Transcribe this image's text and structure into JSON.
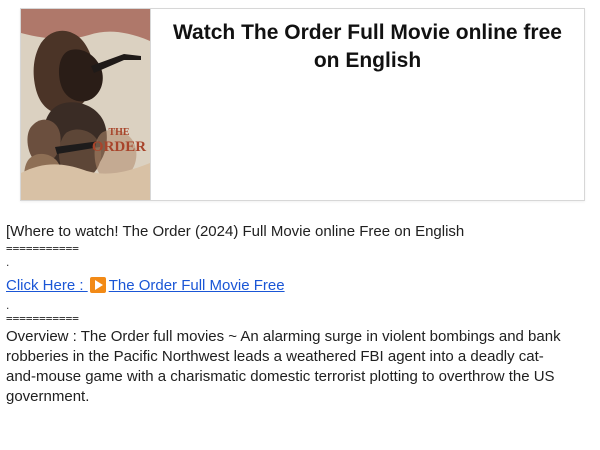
{
  "card": {
    "title": "Watch The Order Full Movie online free on English",
    "poster_word": "THE ORDER"
  },
  "content": {
    "intro": "[Where to watch! The Order (2024) Full Movie online Free on English",
    "separator": "===========",
    "dot": ".",
    "link_prefix": "Click Here : ",
    "link_icon": "play-icon",
    "link_text": "The Order Full Movie Free",
    "overview": "Overview : The Order full movies ~ An alarming surge in violent bombings and bank robberies in the Pacific Northwest leads a weathered FBI agent into a deadly cat-and-mouse game with a charismatic domestic terrorist plotting to overthrow the US government."
  },
  "colors": {
    "link": "#1a56d6",
    "play_icon": "#f28a16",
    "poster_accent": "#a8442a"
  }
}
